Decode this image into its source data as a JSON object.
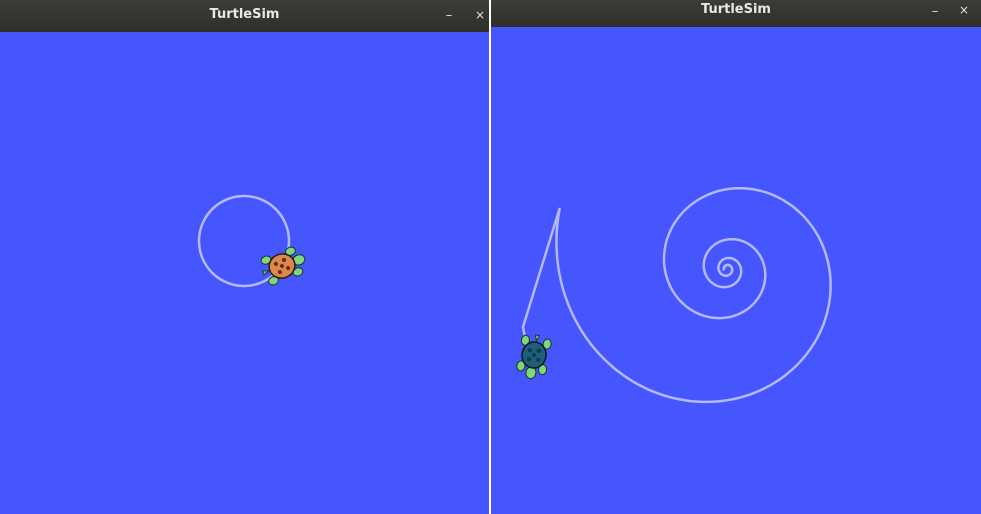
{
  "colors": {
    "canvas_background": "#4556ff",
    "titlebar": "#33322f",
    "title_text": "#e8e8e8",
    "pen": "#b3b8ff",
    "turtle_left_shell": "#d98a4a",
    "turtle_right_shell": "#1f5f7a",
    "turtle_body": "#7fd67f"
  },
  "windows": [
    {
      "title": "TurtleSim",
      "minimize_label": "–",
      "close_label": "×",
      "drawing": "circle",
      "turtle_icon": "turtle-orange-icon"
    },
    {
      "title": "TurtleSim",
      "minimize_label": "–",
      "close_label": "×",
      "drawing": "spiral",
      "turtle_icon": "turtle-blue-icon"
    }
  ]
}
